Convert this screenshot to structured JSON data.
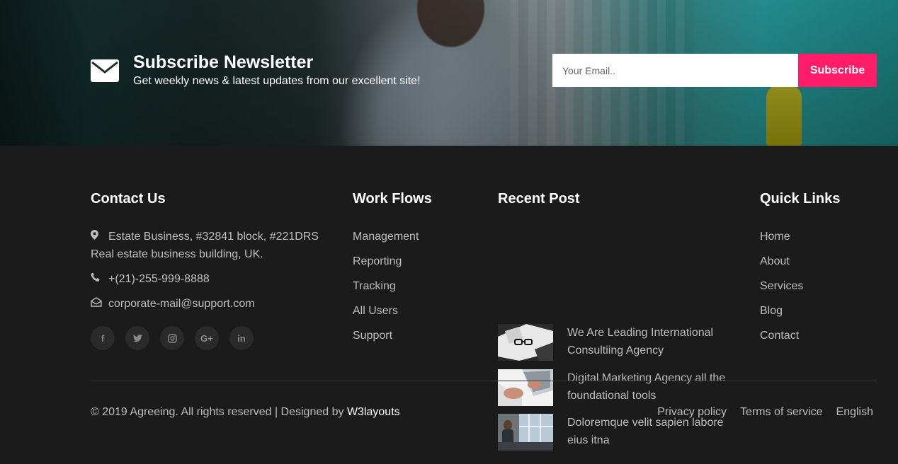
{
  "newsletter": {
    "title": "Subscribe Newsletter",
    "subtitle": "Get weekly news & latest updates from our excellent site!",
    "email_placeholder": "Your Email..",
    "button_label": "Subscribe",
    "icon": "envelope-icon",
    "button_color": "#ff1c68"
  },
  "contact": {
    "heading": "Contact Us",
    "address_line1": "Estate Business, #32841 block, #221DRS",
    "address_line2": "Real estate business building, UK.",
    "phone": "+(21)-255-999-8888",
    "email": "corporate-mail@support.com",
    "socials": [
      {
        "icon": "facebook-icon",
        "glyph": "f"
      },
      {
        "icon": "twitter-icon",
        "glyph": "t"
      },
      {
        "icon": "instagram-icon",
        "glyph": "◎"
      },
      {
        "icon": "google-plus-icon",
        "glyph": "G+"
      },
      {
        "icon": "linkedin-icon",
        "glyph": "in"
      }
    ]
  },
  "workflows": {
    "heading": "Work Flows",
    "items": [
      "Management",
      "Reporting",
      "Tracking",
      "All Users",
      "Support"
    ]
  },
  "recent_posts": {
    "heading": "Recent Post",
    "items": [
      {
        "title": "We Are Leading International Consultiing Agency"
      },
      {
        "title": "Digital Marketing Agency all the foundational tools"
      },
      {
        "title": "Doloremque velit sapien labore eius itna"
      }
    ]
  },
  "quick_links": {
    "heading": "Quick Links",
    "items": [
      "Home",
      "About",
      "Services",
      "Blog",
      "Contact"
    ]
  },
  "bottom": {
    "copyright": "© 2019 Agreeing. All rights reserved | Designed by ",
    "brand": "W3layouts",
    "links": [
      "Privacy policy",
      "Terms of service",
      "English"
    ]
  }
}
